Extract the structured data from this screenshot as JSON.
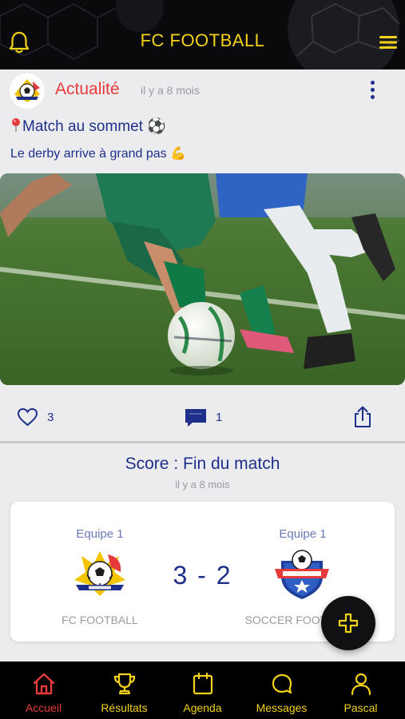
{
  "header": {
    "title": "FC FOOTBALL",
    "left_icon": "bell-icon",
    "right_icon": "menu-icon"
  },
  "post": {
    "category": "Actualité",
    "time": "il y a 8 mois",
    "title": "Match au sommet",
    "title_prefix_icon": "pin-icon",
    "title_suffix_emoji": "⚽",
    "text": "Le derby arrive à grand pas",
    "text_suffix_emoji": "💪",
    "likes": "3",
    "comments": "1"
  },
  "score_card": {
    "title": "Score : Fin du match",
    "time": "il y a 8 mois",
    "home": {
      "label": "Equipe 1",
      "name": "FC FOOTBALL"
    },
    "away": {
      "label": "Equipe 1",
      "name": "SOCCER FOOTBALL"
    },
    "score": "3 - 2"
  },
  "nav": {
    "items": [
      {
        "label": "Accueil",
        "icon": "home-icon",
        "active": true
      },
      {
        "label": "Résultats",
        "icon": "trophy-icon",
        "active": false
      },
      {
        "label": "Agenda",
        "icon": "calendar-icon",
        "active": false
      },
      {
        "label": "Messages",
        "icon": "chat-icon",
        "active": false
      },
      {
        "label": "Pascal",
        "icon": "user-icon",
        "active": false
      }
    ]
  },
  "colors": {
    "accent_yellow": "#f2d21a",
    "brand_blue": "#1e2f8a",
    "category_red": "#e53b3b",
    "muted_grey": "#9a9aa2",
    "background": "#ececee"
  }
}
